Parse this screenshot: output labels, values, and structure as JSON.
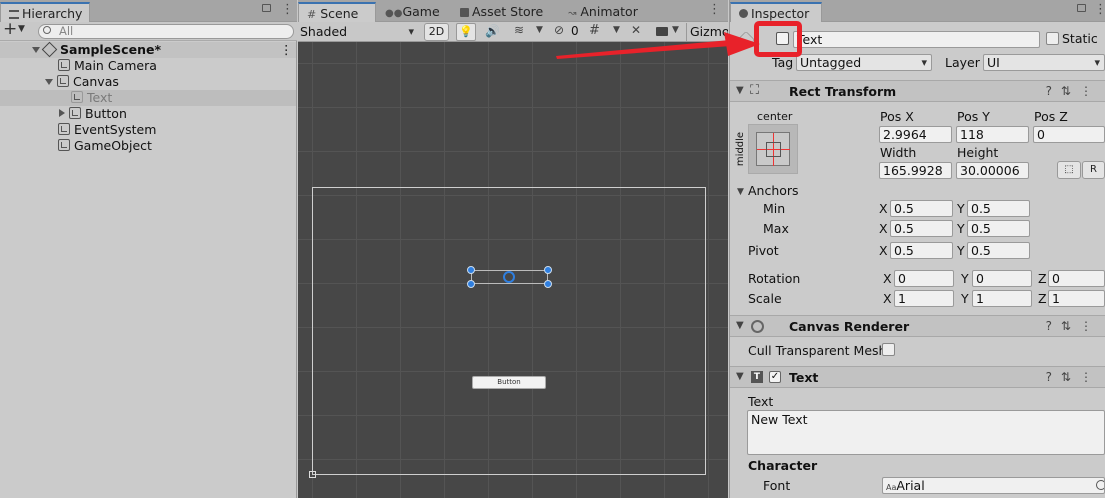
{
  "hierarchy": {
    "tab_label": "Hierarchy",
    "add_label": "+",
    "search_placeholder": "All",
    "scene_name": "SampleScene*",
    "items": [
      {
        "label": "Main Camera"
      },
      {
        "label": "Canvas"
      },
      {
        "label": "Text"
      },
      {
        "label": "Button"
      },
      {
        "label": "EventSystem"
      },
      {
        "label": "GameObject"
      }
    ]
  },
  "scene_view": {
    "tabs": [
      {
        "label": "Scene",
        "icon": "grid-icon"
      },
      {
        "label": "Game",
        "icon": "gamepad-icon"
      },
      {
        "label": "Asset Store",
        "icon": "bag-icon"
      },
      {
        "label": "Animator",
        "icon": "animator-icon"
      }
    ],
    "shading_mode": "Shaded",
    "mode_2d": "2D",
    "hidden_count": "0",
    "gizmos_label": "Gizmo",
    "button_text": "Button"
  },
  "inspector": {
    "tab_label": "Inspector",
    "object_name": "Text",
    "active": false,
    "static_label": "Static",
    "tag_label": "Tag",
    "tag_value": "Untagged",
    "layer_label": "Layer",
    "layer_value": "UI",
    "rect_transform": {
      "title": "Rect Transform",
      "anchor_preset_top": "center",
      "anchor_preset_side": "middle",
      "pos_x_label": "Pos X",
      "pos_x": "2.9964",
      "pos_y_label": "Pos Y",
      "pos_y": "118",
      "pos_z_label": "Pos Z",
      "pos_z": "0",
      "width_label": "Width",
      "width": "165.9928",
      "height_label": "Height",
      "height": "30.00006",
      "r_label": "R",
      "anchors_label": "Anchors",
      "min_label": "Min",
      "min_x": "0.5",
      "min_y": "0.5",
      "max_label": "Max",
      "max_x": "0.5",
      "max_y": "0.5",
      "pivot_label": "Pivot",
      "pivot_x": "0.5",
      "pivot_y": "0.5",
      "rotation_label": "Rotation",
      "rot_x": "0",
      "rot_y": "0",
      "rot_z": "0",
      "scale_label": "Scale",
      "scale_x": "1",
      "scale_y": "1",
      "scale_z": "1",
      "x": "X",
      "y": "Y",
      "z": "Z"
    },
    "canvas_renderer": {
      "title": "Canvas Renderer",
      "cull_label": "Cull Transparent Mesh"
    },
    "text_component": {
      "title": "Text",
      "text_label": "Text",
      "text_value": "New Text",
      "character_label": "Character",
      "font_label": "Font",
      "font_value": "Arial",
      "font_prefix": "Aa"
    }
  },
  "colors": {
    "annotation": "#e8222a",
    "scene_bg": "#474747",
    "selection": "#2f7fe0"
  }
}
